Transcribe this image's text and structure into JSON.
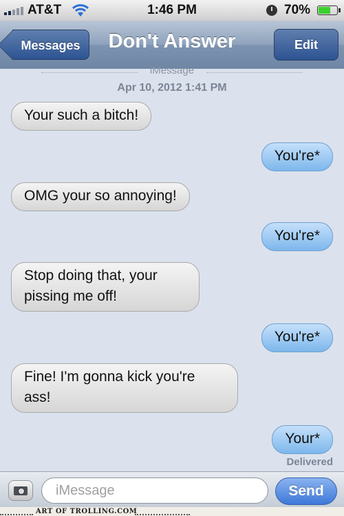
{
  "status_bar": {
    "carrier": "AT&T",
    "time": "1:46 PM",
    "battery_percent": "70%",
    "battery_level": 0.7,
    "icons": [
      "signal-icon",
      "wifi-icon",
      "rotation-lock-icon",
      "battery-icon"
    ]
  },
  "nav": {
    "back_label": "Messages",
    "title": "Don't Answer",
    "edit_label": "Edit"
  },
  "conversation": {
    "service_label": "iMessage",
    "timestamp": "Apr 10, 2012 1:41 PM",
    "messages": [
      {
        "direction": "received",
        "text": "Your such a bitch!"
      },
      {
        "direction": "sent",
        "text": "You're*"
      },
      {
        "direction": "received",
        "text": "OMG your so annoying!"
      },
      {
        "direction": "sent",
        "text": "You're*"
      },
      {
        "direction": "received",
        "text": "Stop doing that, your pissing me off!"
      },
      {
        "direction": "sent",
        "text": "You're*"
      },
      {
        "direction": "received",
        "text": "Fine! I'm gonna kick you're ass!"
      },
      {
        "direction": "sent",
        "text": "Your*"
      }
    ],
    "delivered_label": "Delivered"
  },
  "composer": {
    "placeholder": "iMessage",
    "send_label": "Send"
  },
  "watermark": {
    "text": "ART OF TROLLING.COM"
  },
  "colors": {
    "background": "#dbe2ed",
    "sent_bubble": "#7db7ec",
    "received_bubble": "#d6d6d6",
    "nav_bar": "#8ea2bc"
  }
}
